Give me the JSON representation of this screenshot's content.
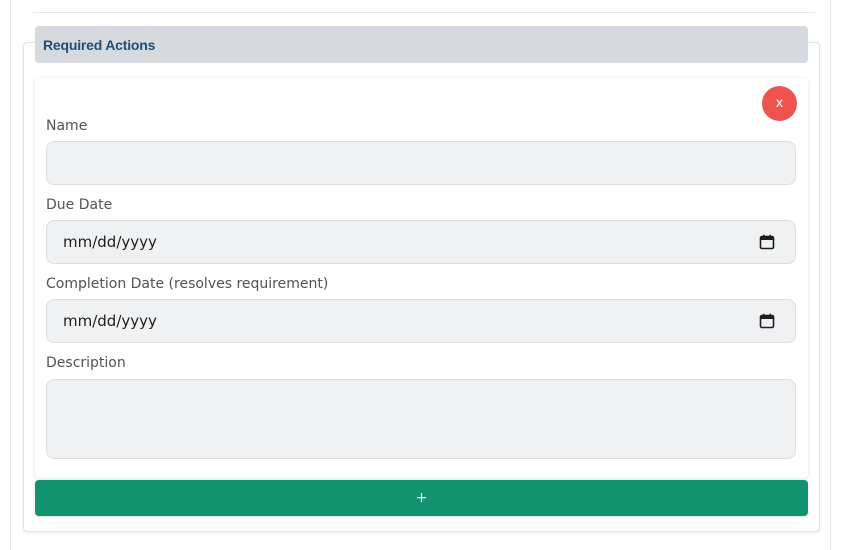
{
  "section": {
    "title": "Required Actions"
  },
  "item": {
    "remove_label": "x",
    "fields": {
      "name": {
        "label": "Name",
        "value": ""
      },
      "due_date": {
        "label": "Due Date",
        "value": "mm/dd/yyyy"
      },
      "completion_date": {
        "label": "Completion Date (resolves requirement)",
        "value": "mm/dd/yyyy"
      },
      "description": {
        "label": "Description",
        "value": ""
      }
    }
  },
  "add_button": {
    "label": "+"
  },
  "colors": {
    "header_bg": "#d6dadf",
    "header_text": "#1f4e79",
    "remove_button": "#ee5350",
    "add_button": "#129370",
    "field_bg": "#f0f1f3"
  },
  "icons": {
    "date_picker": "calendar-icon",
    "remove": "close-icon"
  }
}
